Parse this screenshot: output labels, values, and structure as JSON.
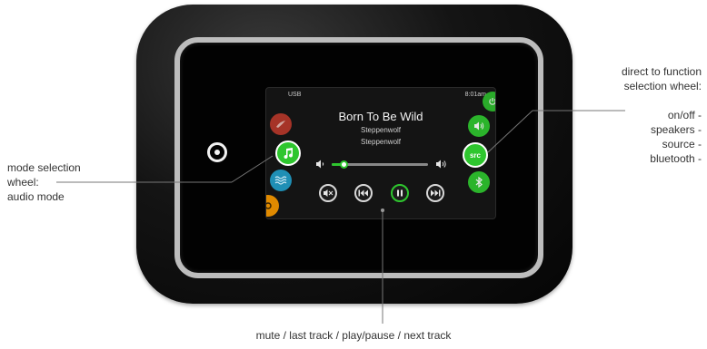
{
  "screen": {
    "source_label": "USB",
    "clock": "8:01am",
    "track": {
      "title": "Born To Be Wild",
      "artist": "Steppenwolf",
      "album": "Steppenwolf"
    },
    "progress": 0.12,
    "icons": {
      "volume_down": "volume-low-icon",
      "volume_up": "volume-high-icon",
      "mute": "mute-icon",
      "previous": "previous-track-icon",
      "play_pause": "pause-icon",
      "next": "next-track-icon"
    },
    "mode_wheel": {
      "items": [
        {
          "icon": "jets-icon",
          "color": "#c0392b"
        },
        {
          "icon": "music-note-icon",
          "color": "#2ec62e"
        },
        {
          "icon": "water-icon",
          "color": "#1f8fb5"
        },
        {
          "icon": "light-icon",
          "color": "#e08a00"
        }
      ]
    },
    "function_wheel": {
      "items": [
        {
          "icon": "power-icon",
          "color": "#2ec62e"
        },
        {
          "icon": "speaker-icon",
          "color": "#2ec62e"
        },
        {
          "label": "src",
          "icon": "source-icon",
          "color": "#2ec62e"
        },
        {
          "icon": "bluetooth-icon",
          "color": "#2ec62e"
        }
      ]
    },
    "accent_color": "#2ec62e"
  },
  "annotations": {
    "left": [
      "mode selection",
      "wheel:",
      "audio mode"
    ],
    "right_header": [
      "direct to function",
      "selection wheel:"
    ],
    "right_items": [
      "on/off -",
      "speakers -",
      "source -",
      "bluetooth -"
    ],
    "bottom": "mute / last track / play/pause / next track"
  }
}
